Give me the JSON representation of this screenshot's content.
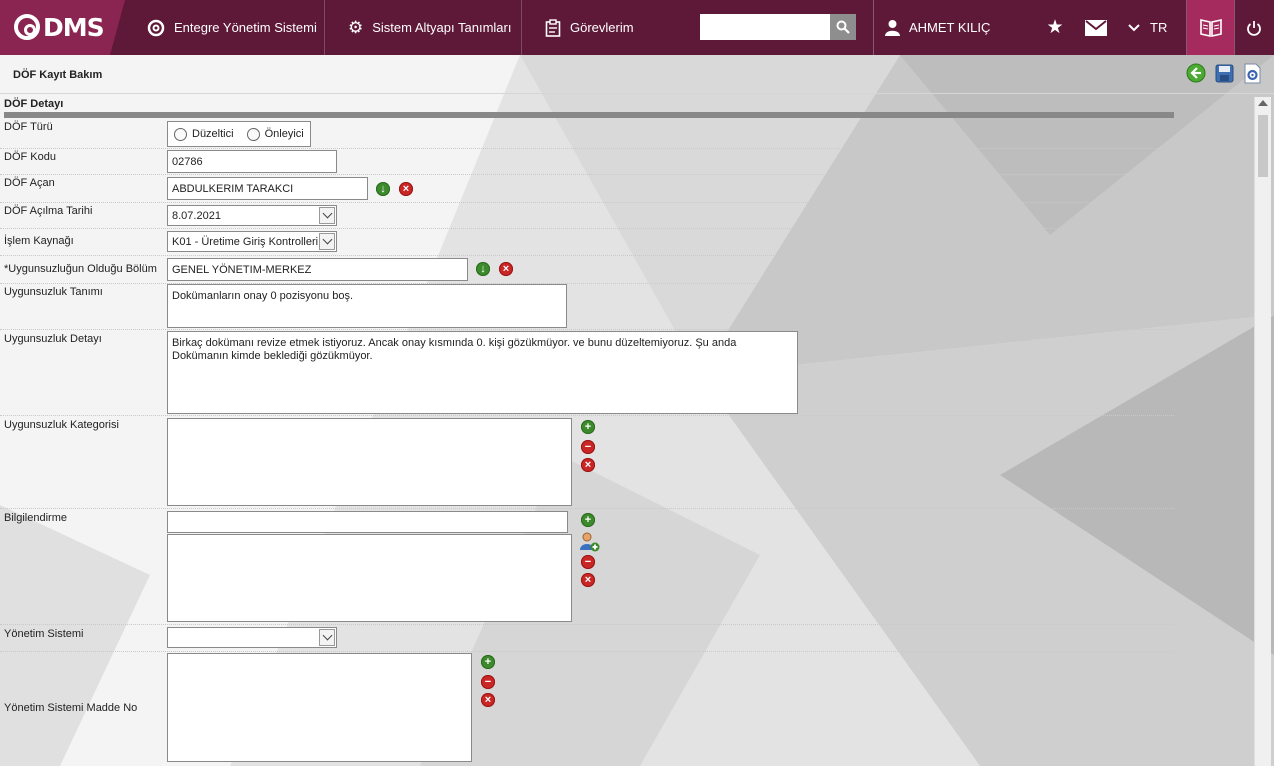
{
  "app": {
    "logo_text": "DMS"
  },
  "topnav": {
    "items": [
      {
        "label": "Entegre Yönetim Sistemi",
        "icon": "q-logo-icon"
      },
      {
        "label": "Sistem Altyapı Tanımları",
        "icon": "gear-icon"
      },
      {
        "label": "Görevlerim",
        "icon": "clipboard-icon"
      }
    ],
    "search": {
      "value": "",
      "placeholder": ""
    },
    "user_name": "AHMET KILIÇ",
    "language": "TR"
  },
  "page": {
    "title": "DÖF Kayıt Bakım",
    "section_title": "DÖF Detayı"
  },
  "form": {
    "dof_turu": {
      "label": "DÖF Türü",
      "options": [
        "Düzeltici",
        "Önleyici"
      ]
    },
    "dof_kodu": {
      "label": "DÖF Kodu",
      "value": "02786"
    },
    "dof_acan": {
      "label": "DÖF Açan",
      "value": "ABDULKERIM TARAKCI"
    },
    "dof_acilma_tarihi": {
      "label": "DÖF Açılma Tarihi",
      "value": "8.07.2021"
    },
    "islem_kaynagi": {
      "label": "İşlem Kaynağı",
      "value": "K01 - Üretime Giriş Kontrolleri"
    },
    "uygunsuzlugun_oldugu_bolum": {
      "label": "*Uygunsuzluğun Olduğu Bölüm",
      "value": "GENEL YÖNETIM-MERKEZ"
    },
    "uygunsuzluk_tanimi": {
      "label": "Uygunsuzluk Tanımı",
      "value": "Dokümanların onay 0 pozisyonu boş."
    },
    "uygunsuzluk_detayi": {
      "label": "Uygunsuzluk Detayı",
      "line1": "Birkaç dokümanı revize etmek istiyoruz. Ancak onay kısmında 0. kişi gözükmüyor. ve bunu düzeltemiyoruz. Şu anda",
      "line2": "Dokümanın kimde beklediği  gözükmüyor."
    },
    "uygunsuzluk_kategorisi": {
      "label": "Uygunsuzluk Kategorisi",
      "value": ""
    },
    "bilgilendirme": {
      "label": "Bilgilendirme",
      "value": ""
    },
    "yonetim_sistemi": {
      "label": "Yönetim Sistemi",
      "value": ""
    },
    "yonetim_sistemi_madde_no": {
      "label": "Yönetim Sistemi Madde No",
      "value": ""
    }
  },
  "colors": {
    "topbar": "#5e1838",
    "logo_bg": "#8a2450",
    "active_btn": "#a52b5e",
    "add_green": "#3d8a2d",
    "remove_red": "#c92626"
  }
}
